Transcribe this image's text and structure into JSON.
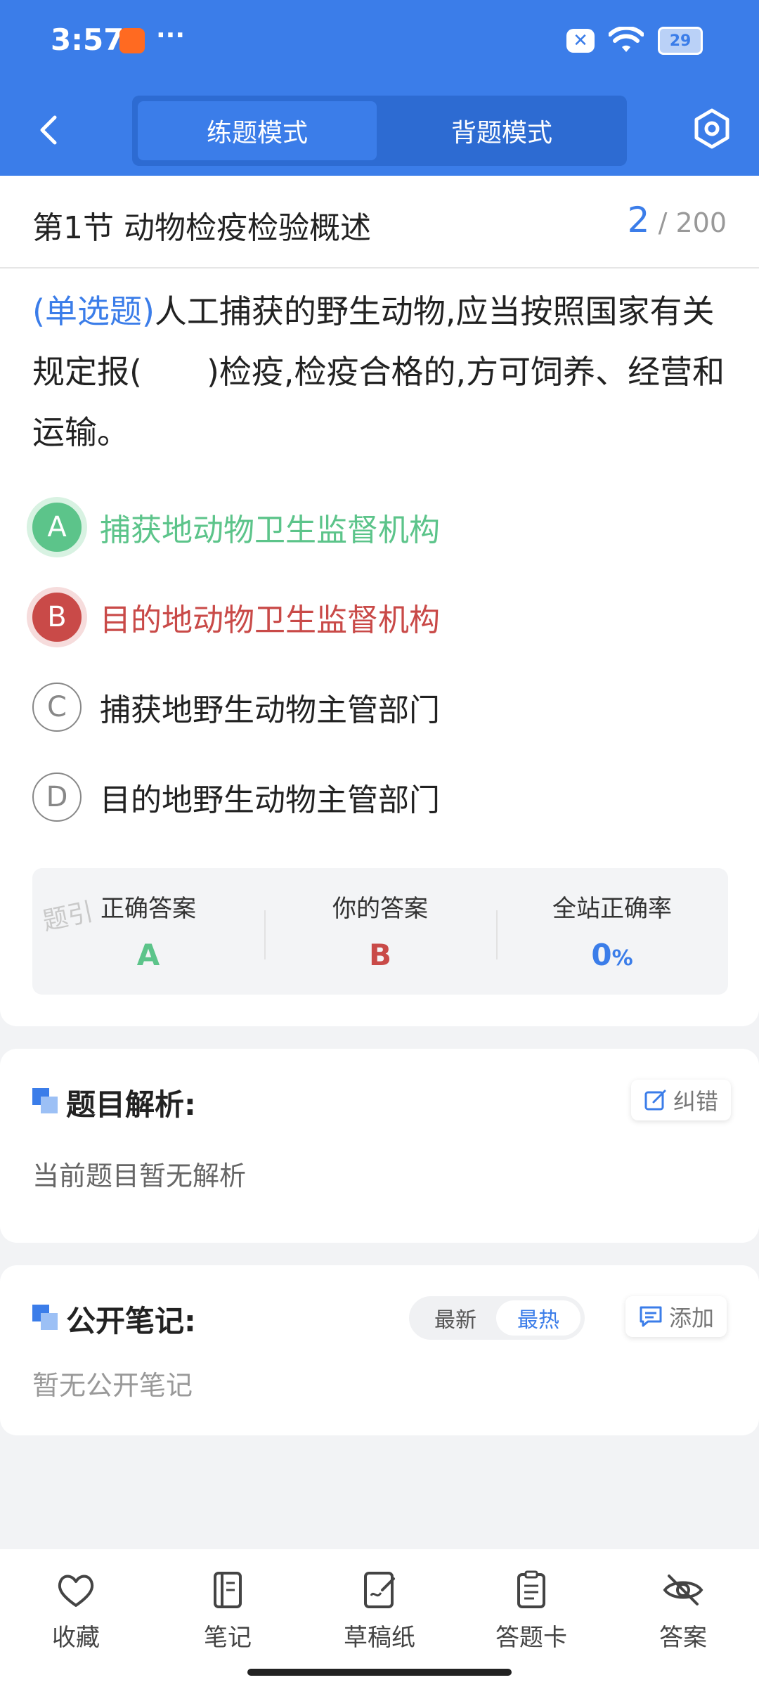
{
  "status_bar": {
    "time": "3:57",
    "dots": "···",
    "battery": "29"
  },
  "nav": {
    "tabs": [
      "练题模式",
      "背题模式"
    ],
    "active_tab": "练题模式"
  },
  "section": {
    "title": "第1节 动物检疫检验概述",
    "current": "2",
    "total": "/ 200"
  },
  "question": {
    "type": "(单选题)",
    "text": "人工捕获的野生动物,应当按照国家有关规定报(　　)检疫,检疫合格的,方可饲养、经营和运输。"
  },
  "options": [
    {
      "letter": "A",
      "text": "捕获地动物卫生监督机构",
      "state": "correct"
    },
    {
      "letter": "B",
      "text": "目的地动物卫生监督机构",
      "state": "wrong"
    },
    {
      "letter": "C",
      "text": "捕获地野生动物主管部门",
      "state": "normal"
    },
    {
      "letter": "D",
      "text": "目的地野生动物主管部门",
      "state": "normal"
    }
  ],
  "answer_summary": {
    "correct_label": "正确答案",
    "correct_value": "A",
    "yours_label": "你的答案",
    "yours_value": "B",
    "rate_label": "全站正确率",
    "rate_value": "0",
    "rate_unit": "%",
    "watermark": "题引"
  },
  "analysis": {
    "title": "题目解析:",
    "body": "当前题目暂无解析",
    "report_label": "纠错"
  },
  "notes": {
    "title": "公开笔记:",
    "body": "暂无公开笔记",
    "sort_options": [
      "最新",
      "最热"
    ],
    "active_sort": "最热",
    "add_label": "添加"
  },
  "bottom_tabs": [
    {
      "label": "收藏",
      "icon": "heart-icon"
    },
    {
      "label": "笔记",
      "icon": "notebook-icon"
    },
    {
      "label": "草稿纸",
      "icon": "draft-icon"
    },
    {
      "label": "答题卡",
      "icon": "answer-card-icon"
    },
    {
      "label": "答案",
      "icon": "eye-off-icon"
    }
  ],
  "colors": {
    "primary": "#3b7de9",
    "correct": "#5cc48a",
    "wrong": "#c94a48"
  }
}
